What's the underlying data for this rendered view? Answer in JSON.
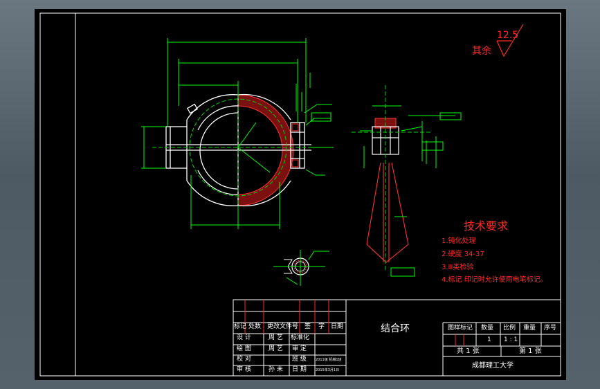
{
  "drawing": {
    "part_name": "结合环",
    "school": "成都理工大学",
    "roughness": {
      "value": "12.5",
      "label": "其余"
    },
    "tech_requirements": {
      "title": "技术要求",
      "items": [
        "1.钝化处理",
        "2.硬度 34-37",
        "3.Ⅲ类检验",
        "4.标记 印记时允许使用电笔标记。"
      ]
    },
    "title_block": {
      "header": [
        "标记",
        "处数",
        "更改文件号",
        "签",
        "字",
        "日期"
      ],
      "rows": [
        {
          "label": "设 计",
          "name": "周 艺",
          "role": "标准化",
          "date": ""
        },
        {
          "label": "绘 图",
          "name": "周 艺",
          "role": "审 定",
          "date": ""
        },
        {
          "label": "校 对",
          "name": "",
          "role": "班 级",
          "date": "2011级 机械1班"
        },
        {
          "label": "审 核",
          "name": "孙 未",
          "role": "日 期",
          "date": "2015年3月1日"
        }
      ],
      "info_headers": [
        "图样标记",
        "数量",
        "比例",
        "重量",
        "序号"
      ],
      "quantity": "1",
      "scale": "1 : 1",
      "sheets_total": "共 1 张",
      "sheet_no": "第 1 张"
    }
  }
}
